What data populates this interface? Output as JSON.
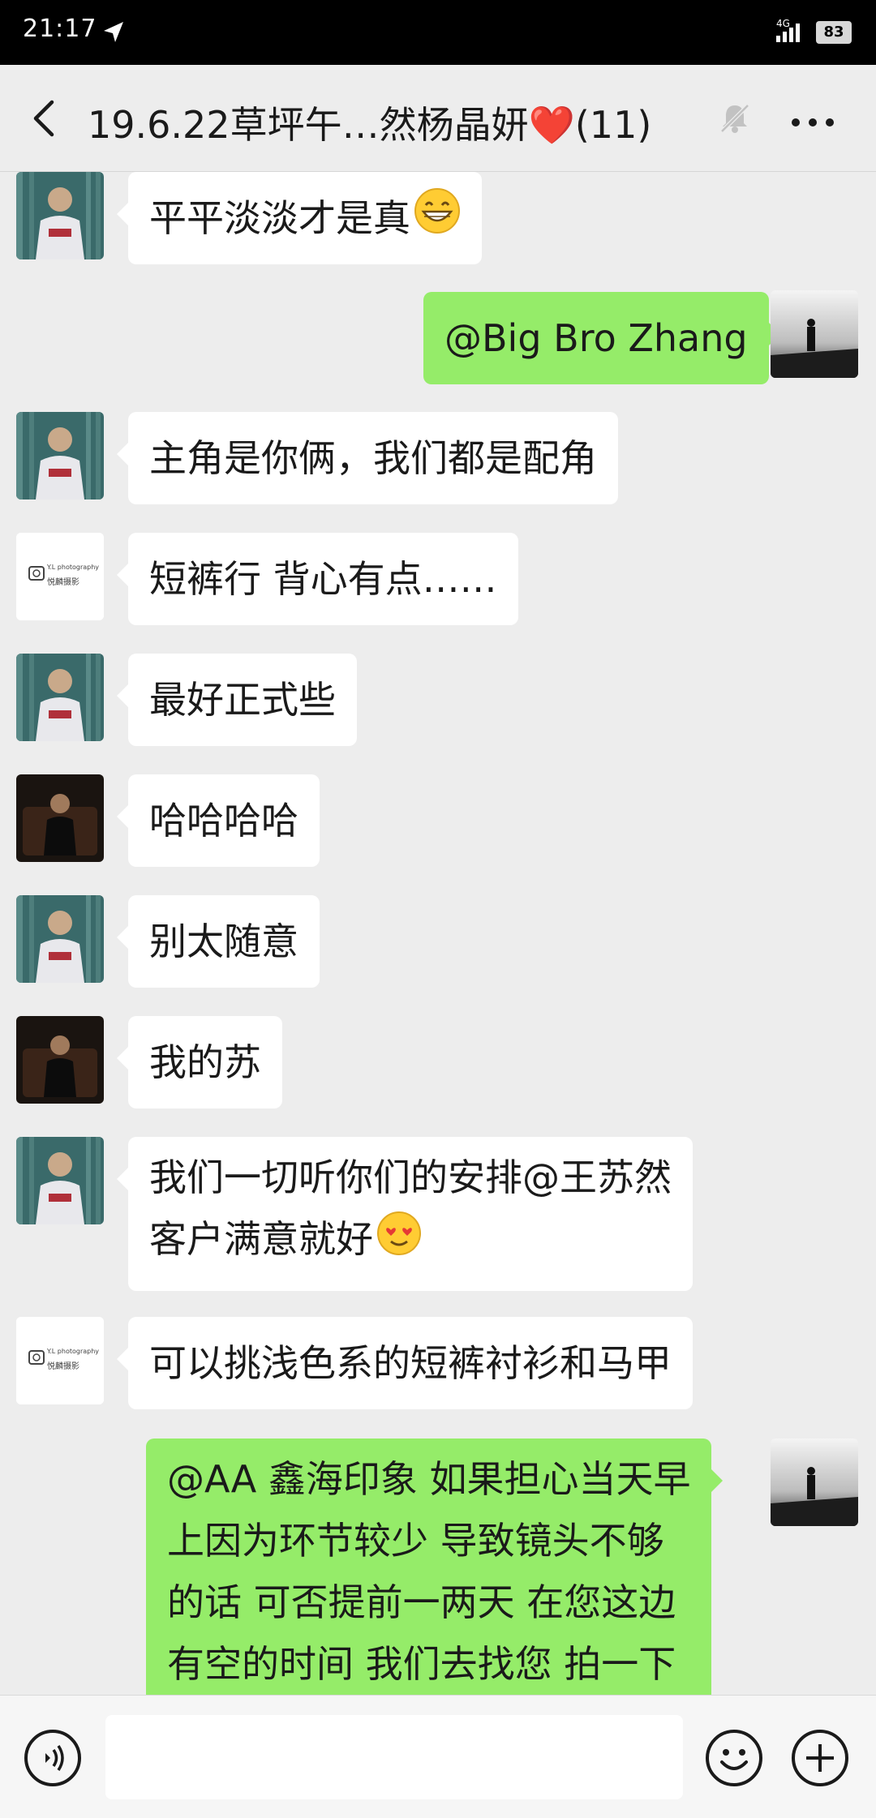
{
  "status_bar": {
    "time": "21:17",
    "network": "4G",
    "battery": "83"
  },
  "header": {
    "title": "19.6.22草坪午…然杨晶妍❤️(11)"
  },
  "messages": [
    {
      "side": "left",
      "avatar": "man-avatar",
      "text": "平平淡淡才是真",
      "emoji": "grin-emoji"
    },
    {
      "side": "right",
      "avatar": "self-avatar",
      "text": "@Big Bro Zhang"
    },
    {
      "side": "left",
      "avatar": "man-avatar",
      "text": "主角是你俩，我们都是配角"
    },
    {
      "side": "left",
      "avatar": "studio-logo-avatar",
      "text": "短裤行  背心有点……"
    },
    {
      "side": "left",
      "avatar": "man-avatar",
      "text": "最好正式些"
    },
    {
      "side": "left",
      "avatar": "dark-avatar",
      "text": "哈哈哈哈"
    },
    {
      "side": "left",
      "avatar": "man-avatar",
      "text": "别太随意"
    },
    {
      "side": "left",
      "avatar": "dark-avatar",
      "text": "我的苏"
    },
    {
      "side": "left",
      "avatar": "man-avatar",
      "lines": [
        "我们一切听你们的安排@王苏然",
        " 客户满意就好"
      ],
      "emoji": "heart-eyes-emoji"
    },
    {
      "side": "left",
      "avatar": "studio-logo-avatar",
      "text": "可以挑浅色系的短裤衬衫和马甲"
    },
    {
      "side": "right",
      "avatar": "self-avatar",
      "lines": [
        "@AA 鑫海印象  如果担心当天早",
        "上因为环节较少 导致镜头不够",
        "的话 可否提前一两天 在您这边",
        "有空的时间 我们去找您 拍一下"
      ]
    }
  ],
  "studio_logo": {
    "line1": "Y.L photography",
    "line2": "悦麟摄影"
  },
  "input": {
    "placeholder": ""
  },
  "colors": {
    "sent_bubble": "#95ec69",
    "received_bubble": "#ffffff",
    "background": "#ededed"
  }
}
